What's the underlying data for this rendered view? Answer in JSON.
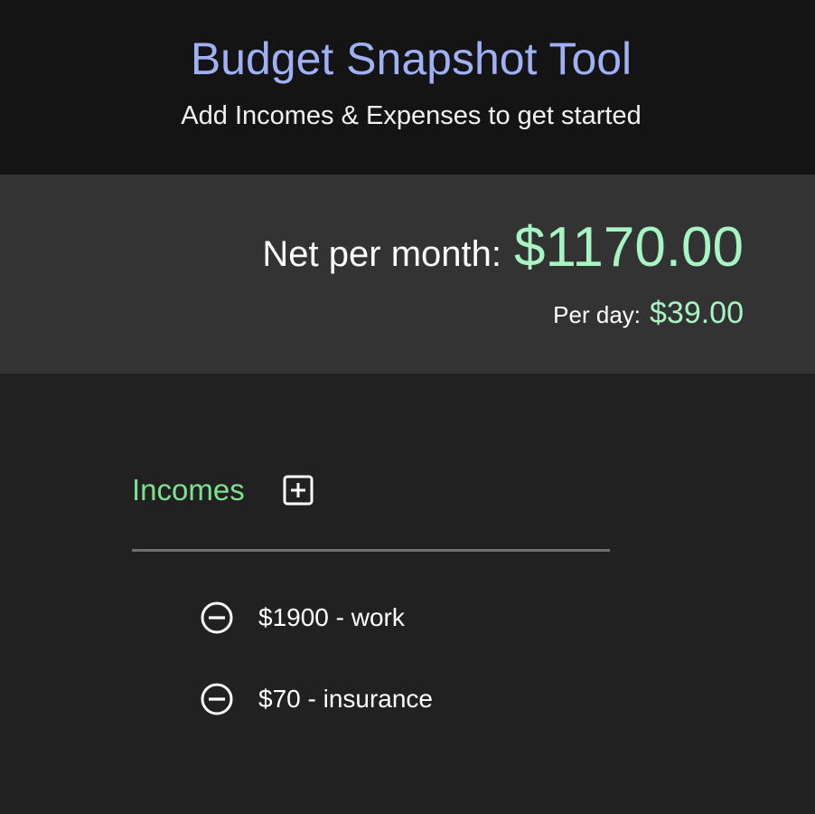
{
  "header": {
    "title": "Budget Snapshot Tool",
    "subtitle": "Add Incomes & Expenses to get started"
  },
  "summary": {
    "net_label": "Net per month:",
    "net_value": "$1170.00",
    "day_label": "Per day:",
    "day_value": "$39.00"
  },
  "incomes": {
    "title": "Incomes",
    "add_icon": "plus-square-icon",
    "remove_icon": "minus-circle-icon",
    "items": [
      {
        "text": "$1900 - work"
      },
      {
        "text": "$70 - insurance"
      }
    ]
  },
  "colors": {
    "title": "#9fb0f4",
    "accent_value": "#a8f5c4",
    "section_title": "#7fe08f",
    "header_bg": "#141414",
    "summary_bg": "#333333",
    "page_bg": "#212121"
  }
}
